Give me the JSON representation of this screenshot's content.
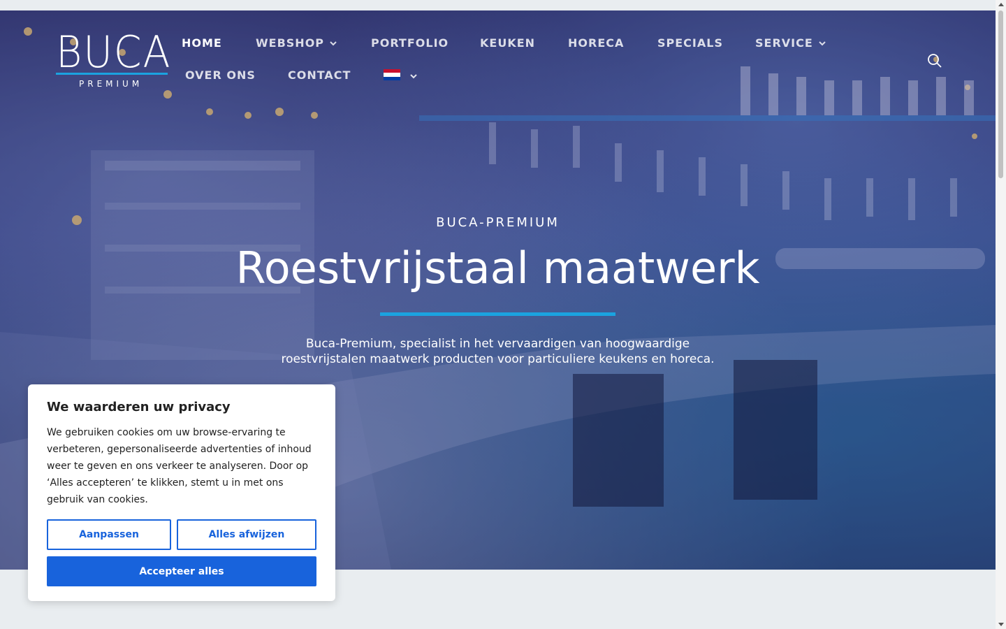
{
  "brand": {
    "logo_word": "BUCA",
    "logo_sub": "PREMIUM",
    "accent_color": "#1ba3e0"
  },
  "nav": {
    "items": [
      {
        "label": "HOME",
        "active": true
      },
      {
        "label": "WEBSHOP",
        "dropdown": true
      },
      {
        "label": "PORTFOLIO"
      },
      {
        "label": "KEUKEN"
      },
      {
        "label": "HORECA"
      },
      {
        "label": "SPECIALS"
      },
      {
        "label": "SERVICE",
        "dropdown": true
      },
      {
        "label": "OVER ONS"
      },
      {
        "label": "CONTACT"
      }
    ],
    "language_icon": "netherlands-flag-icon",
    "search_icon": "search-icon"
  },
  "hero": {
    "eyebrow": "BUCA-PREMIUM",
    "title": "Roestvrijstaal maatwerk",
    "description_line1": "Buca-Premium, specialist in het vervaardigen van hoogwaardige",
    "description_line2": "roestvrijstalen maatwerk producten voor particuliere keukens en horeca."
  },
  "cookie_banner": {
    "title": "We waarderen uw privacy",
    "text": "We gebruiken cookies om uw browse-ervaring te verbeteren, gepersonaliseerde advertenties of inhoud weer te geven en ons verkeer te analyseren. Door op ‘Alles accepteren’ te klikken, stemt u in met ons gebruik van cookies.",
    "customize_label": "Aanpassen",
    "reject_label": "Alles afwijzen",
    "accept_label": "Accepteer alles",
    "button_color": "#1863dc"
  }
}
